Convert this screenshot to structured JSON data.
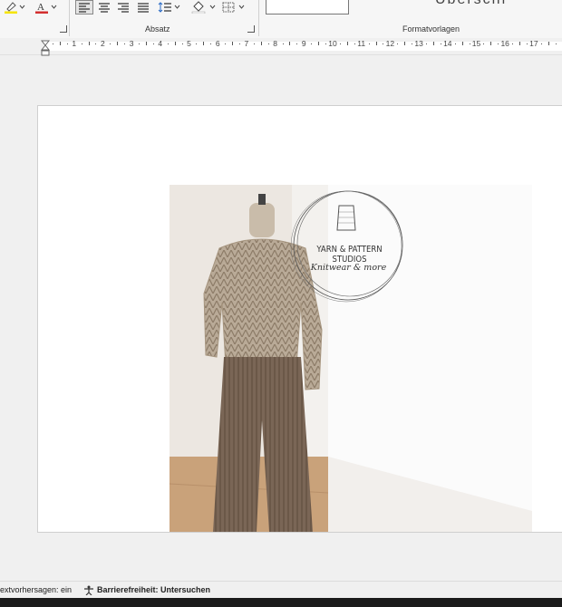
{
  "ribbon": {
    "paragraph_group_label": "Absatz",
    "styles_group_label": "Formatvorlagen",
    "style_preview_text": "Überschr",
    "highlight_color": "#f5e400",
    "font_color": "#d32f2f"
  },
  "ruler": {
    "marks": [
      "1",
      "2",
      "3",
      "4",
      "5",
      "6",
      "7",
      "8",
      "9",
      "10",
      "11",
      "12",
      "13",
      "14",
      "15",
      "16",
      "17"
    ]
  },
  "document": {
    "logo_text": {
      "title": "YARN & PATTERN STUDIOS",
      "subtitle": "Knitwear & more"
    }
  },
  "status_bar": {
    "text_predictions": "extvorhersagen: ein",
    "accessibility": "Barrierefreiheit: Untersuchen"
  }
}
